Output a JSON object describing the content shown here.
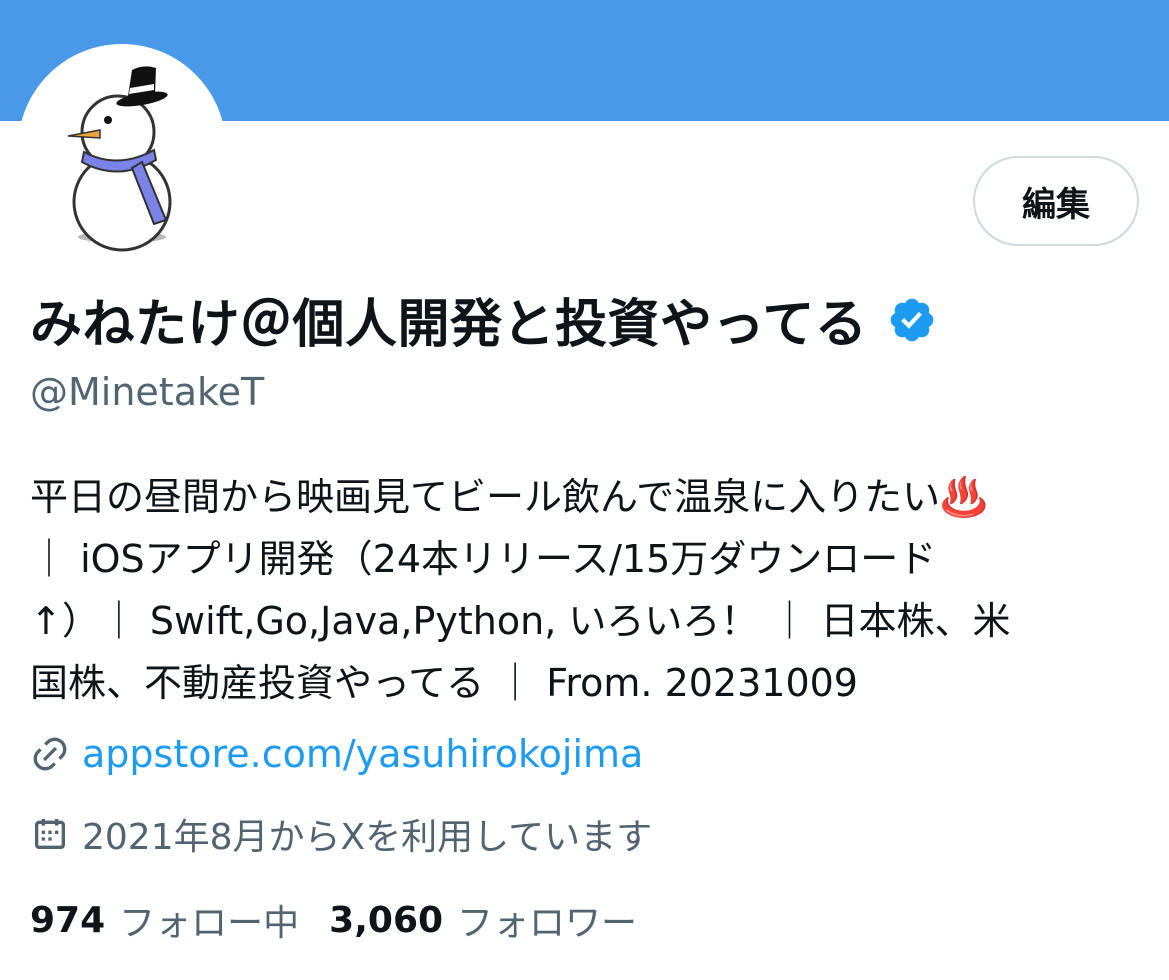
{
  "profile": {
    "display_name": "みねたけ＠個人開発と投資やってる",
    "handle": "@MinetakeT",
    "edit_label": "編集",
    "bio_lines": [
      "平日の昼間から映画見てビール飲んで温泉に入りたい♨️",
      "｜  iOSアプリ開発（24本リリース/15万ダウンロード",
      "↑）｜ Swift,Go,Java,Python, いろいろ！ ｜ 日本株、米",
      "国株、不動産投資やってる ｜ From. 20231009"
    ],
    "link": "appstore.com/yasuhirokojima",
    "joined": "2021年8月からXを利用しています",
    "following_count": "974",
    "following_label": "フォロー中",
    "followers_count": "3,060",
    "followers_label": "フォロワー"
  },
  "icons": {
    "verified": "verified-badge-icon",
    "link": "link-icon",
    "calendar": "calendar-icon",
    "apple": "apple-icon",
    "avatar": "snowman-avatar"
  },
  "colors": {
    "banner": "#4a99e9",
    "accent": "#1d9bf0",
    "secondary_text": "#536471"
  }
}
